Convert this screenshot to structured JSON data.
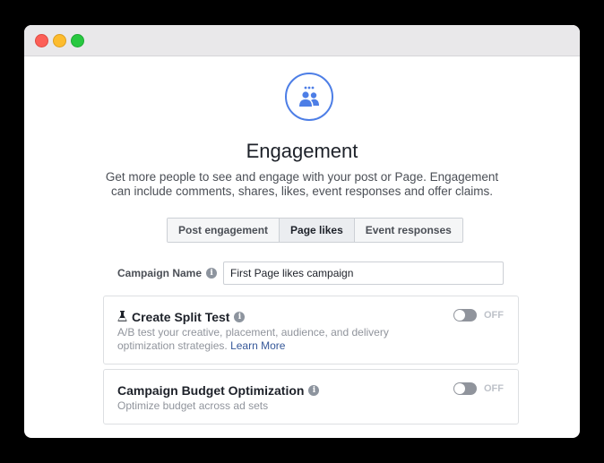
{
  "window": {
    "controls": [
      "close",
      "minimize",
      "maximize"
    ]
  },
  "objective": {
    "icon": "people-group-icon",
    "accent_color": "#4d7ee6",
    "title": "Engagement",
    "description_lines": [
      "Get more people to see and engage with your post or Page. Engagement",
      "can include comments, shares, likes, event responses and offer claims."
    ]
  },
  "tabs": [
    {
      "label": "Post engagement",
      "active": false
    },
    {
      "label": "Page likes",
      "active": true
    },
    {
      "label": "Event responses",
      "active": false
    }
  ],
  "campaign_name": {
    "label": "Campaign Name",
    "value": "First Page likes campaign"
  },
  "split_test": {
    "icon": "flask-icon",
    "title": "Create Split Test",
    "description_line1": "A/B test your creative, placement, audience, and delivery",
    "description_line2": "optimization strategies.",
    "link": "Learn More",
    "toggle_label": "OFF"
  },
  "budget_optimization": {
    "title": "Campaign Budget Optimization",
    "description": "Optimize budget across ad sets",
    "toggle_label": "OFF"
  }
}
